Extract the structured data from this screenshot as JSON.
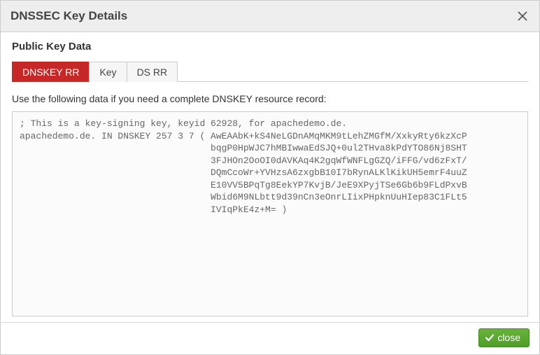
{
  "dialog": {
    "title": "DNSSEC Key Details",
    "section_title": "Public Key Data",
    "instruction": "Use the following data if you need a complete DNSKEY resource record:"
  },
  "tabs": [
    {
      "label": "DNSKEY RR",
      "active": true
    },
    {
      "label": "Key",
      "active": false
    },
    {
      "label": "DS RR",
      "active": false
    }
  ],
  "key_data": "; This is a key-signing key, keyid 62928, for apachedemo.de.\napachedemo.de. IN DNSKEY 257 3 7 ( AwEAAbK+kS4NeLGDnAMqMKM9tLehZMGfM/XxkyRty6kzXcP\n                                   bqgP0HpWJC7hMBIwwaEdSJQ+0ul2THva8kPdYTO86Nj8SHT\n                                   3FJHOn2OoOI0dAVKAq4K2gqWfWNFLgGZQ/iFFG/vd6zFxT/\n                                   DQmCcoWr+YVHzsA6zxgbB10I7bRynALKlKikUH5emrF4uuZ\n                                   E10VV5BPqTg8EekYP7KvjB/JeE9XPyjTSe6Gb6b9FLdPxvB\n                                   Wbid6M9NLbtt9d39nCn3eOnrLIixPHpknUuHIep83C1FLt5\n                                   IVIqPkE4z+M= )",
  "footer": {
    "close_label": "close"
  }
}
